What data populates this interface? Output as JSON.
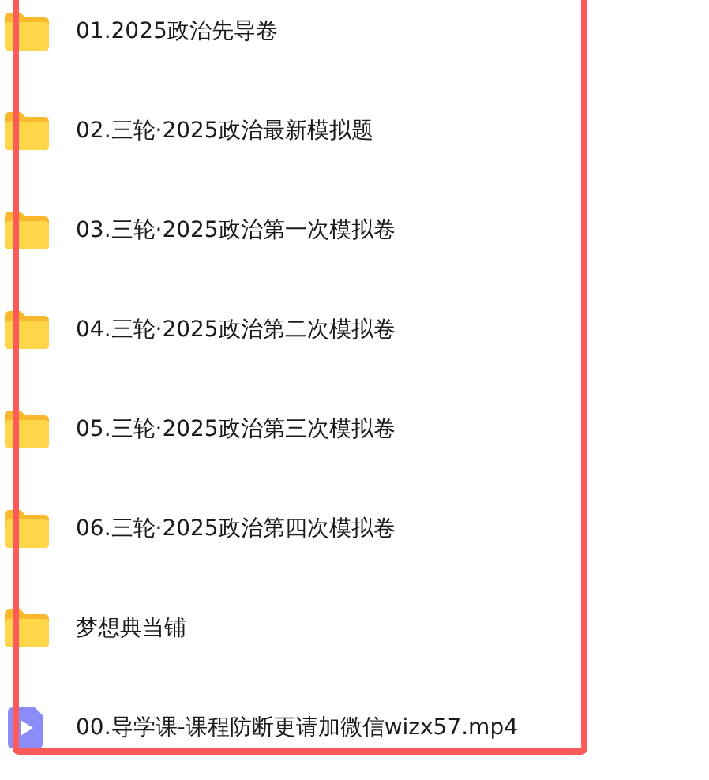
{
  "files": [
    {
      "kind": "folder",
      "name": "01.2025政治先导卷"
    },
    {
      "kind": "folder",
      "name": "02.三轮·2025政治最新模拟题"
    },
    {
      "kind": "folder",
      "name": "03.三轮·2025政治第一次模拟卷"
    },
    {
      "kind": "folder",
      "name": "04.三轮·2025政治第二次模拟卷"
    },
    {
      "kind": "folder",
      "name": "05.三轮·2025政治第三次模拟卷"
    },
    {
      "kind": "folder",
      "name": "06.三轮·2025政治第四次模拟卷"
    },
    {
      "kind": "folder",
      "name": "梦想典当铺"
    },
    {
      "kind": "video",
      "name": "00.导学课-课程防断更请加微信wizx57.mp4"
    }
  ]
}
